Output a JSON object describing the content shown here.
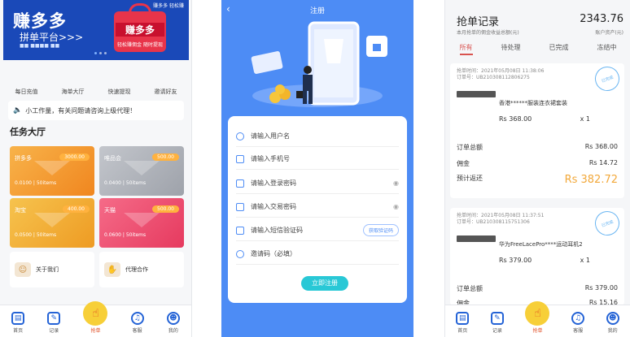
{
  "home": {
    "banner_title": "赚多多",
    "banner_subtitle": "拼单平台>>>",
    "banner_small": "■■  ■■■■  ■■",
    "bag_text": "赚多多",
    "bag_sub": "轻松赚佣金 随时提现",
    "corner_text": "赚多多\n轻松赚",
    "menu": [
      "每日充值",
      "海单大厅",
      "快速提现",
      "邀请好友"
    ],
    "notice": "小工作量，有关问题请咨询上级代理！",
    "section_title": "任务大厅",
    "cards": [
      {
        "name": "拼多多",
        "price": "3000.00",
        "detail": "0.0100 | 50items",
        "color": "#f59e2a"
      },
      {
        "name": "唯品会",
        "price": "500.00",
        "detail": "0.0400 | 50items",
        "color": "#b3b6bd"
      },
      {
        "name": "淘宝",
        "price": "400.00",
        "detail": "0.0500 | 50items",
        "color": "#f2b63c"
      },
      {
        "name": "天猫",
        "price": "500.00",
        "detail": "0.0600 | 50items",
        "color": "#f0506e"
      }
    ],
    "tiles": [
      "关于我们",
      "代理合作"
    ],
    "tabbar": [
      "首页",
      "记录",
      "抢单",
      "客服",
      "我的"
    ]
  },
  "register": {
    "title": "注册",
    "fields": [
      "请输入用户名",
      "请输入手机号",
      "请输入登录密码",
      "请输入交易密码",
      "请输入短信验证码",
      "邀请码（必填）"
    ],
    "code_button": "获取验证码",
    "submit": "立即注册"
  },
  "records": {
    "title": "抢单记录",
    "subtitle": "本月抢单的佣金收益总额(元)",
    "total": "2343.76",
    "total_label": "账户资产(元)",
    "tabs": [
      "所有",
      "待处理",
      "已完成",
      "冻结中"
    ],
    "orders": [
      {
        "time_label": "抢单时间：2021年05月08日 11:38:06",
        "order_no": "订单号：UB210308112806275",
        "stamp": "已完成",
        "product": "香港******服装连衣裙套装",
        "price": "Rs 368.00",
        "qty": "x 1",
        "total_label": "订单总额",
        "total_value": "Rs 368.00",
        "commission_label": "佣金",
        "commission_value": "Rs 14.72",
        "return_label": "预计返还",
        "return_value": "Rs 382.72"
      },
      {
        "time_label": "抢单时间：2021年05月08日 11:37:51",
        "order_no": "订单号：UB210308115751306",
        "stamp": "已完成",
        "product": "华为FreeLacePro****运动耳机2",
        "price": "Rs 379.00",
        "qty": "x 1",
        "total_label": "订单总额",
        "total_value": "Rs 379.00",
        "commission_label": "佣金",
        "commission_value": "Rs 15.16"
      }
    ],
    "tabbar": [
      "首页",
      "记录",
      "抢单",
      "客服",
      "我的"
    ]
  }
}
